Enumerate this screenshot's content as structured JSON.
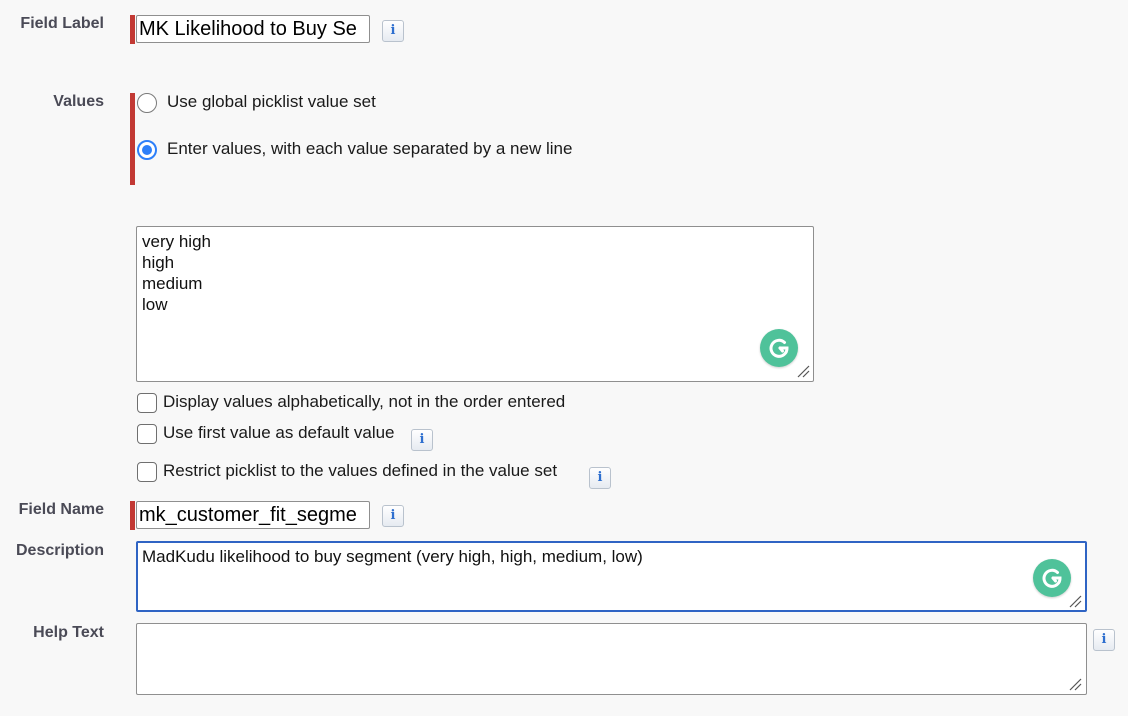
{
  "field_label": {
    "label": "Field Label",
    "value": "MK Likelihood to Buy Se",
    "info": "i"
  },
  "values": {
    "label": "Values",
    "options": [
      {
        "label": "Use global picklist value set",
        "selected": false
      },
      {
        "label": "Enter values, with each value separated by a new line",
        "selected": true
      }
    ],
    "entries": [
      "very high",
      "high",
      "medium",
      "low"
    ],
    "checkboxes": [
      {
        "label": "Display values alphabetically, not in the order entered",
        "checked": false
      },
      {
        "label": "Use first value as default value",
        "checked": false
      },
      {
        "label": "Restrict picklist to the values defined in the value set",
        "checked": false
      }
    ],
    "info": "i"
  },
  "field_name": {
    "label": "Field Name",
    "value": "mk_customer_fit_segme",
    "info": "i"
  },
  "description": {
    "label": "Description",
    "value": "MadKudu likelihood to buy segment (very high, high, medium, low)"
  },
  "help_text": {
    "label": "Help Text",
    "value": "",
    "info": "i"
  },
  "colors": {
    "required_bar": "#c23934",
    "radio_selected": "#2d7ff9",
    "focus_border": "#2f64c4",
    "grammarly": "#4fc29a"
  },
  "icons": [
    "info-icon",
    "grammarly-icon",
    "resize-grip-icon"
  ]
}
